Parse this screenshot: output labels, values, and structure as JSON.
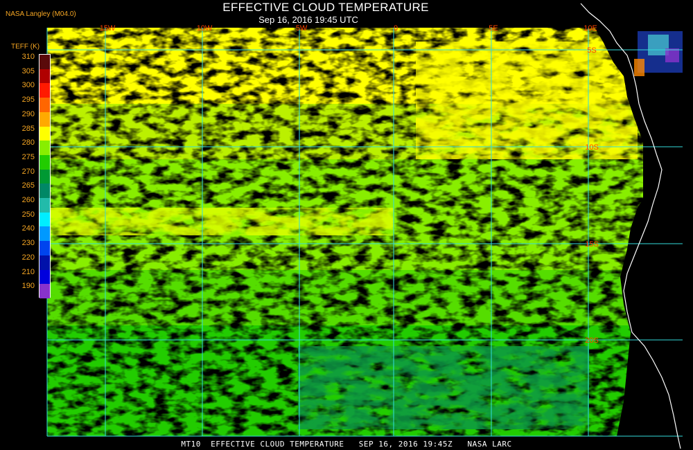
{
  "header": {
    "title": "EFFECTIVE CLOUD TEMPERATURE",
    "subtitle": "Sep 16, 2016 19:45 UTC",
    "source": "NASA Langley (M04.0)"
  },
  "legend": {
    "title": "TEFF (K)",
    "entries": [
      {
        "label": "310",
        "color": "#5a0a0a"
      },
      {
        "label": "305",
        "color": "#b00000"
      },
      {
        "label": "300",
        "color": "#ff1a00"
      },
      {
        "label": "295",
        "color": "#ff6600"
      },
      {
        "label": "290",
        "color": "#ffaa00"
      },
      {
        "label": "285",
        "color": "#ffff00"
      },
      {
        "label": "280",
        "color": "#88ee00"
      },
      {
        "label": "275",
        "color": "#22cc00"
      },
      {
        "label": "270",
        "color": "#009933"
      },
      {
        "label": "265",
        "color": "#008866"
      },
      {
        "label": "260",
        "color": "#22bbaa"
      },
      {
        "label": "250",
        "color": "#00eeff"
      },
      {
        "label": "240",
        "color": "#0099ff"
      },
      {
        "label": "230",
        "color": "#0044ee"
      },
      {
        "label": "220",
        "color": "#0011aa"
      },
      {
        "label": "210",
        "color": "#0000dd"
      },
      {
        "label": "190",
        "color": "#8833cc"
      }
    ]
  },
  "map": {
    "longitude_labels": [
      "15W",
      "10W",
      "5W",
      "0",
      "5E",
      "10E"
    ],
    "latitude_labels": [
      "5S",
      "10S",
      "15S",
      "20S"
    ],
    "grid_color": "#33dddd",
    "coast_color": "#ffffff"
  },
  "footer": {
    "text": "MT10  EFFECTIVE CLOUD TEMPERATURE   SEP 16, 2016 19:45Z   NASA LARC"
  }
}
